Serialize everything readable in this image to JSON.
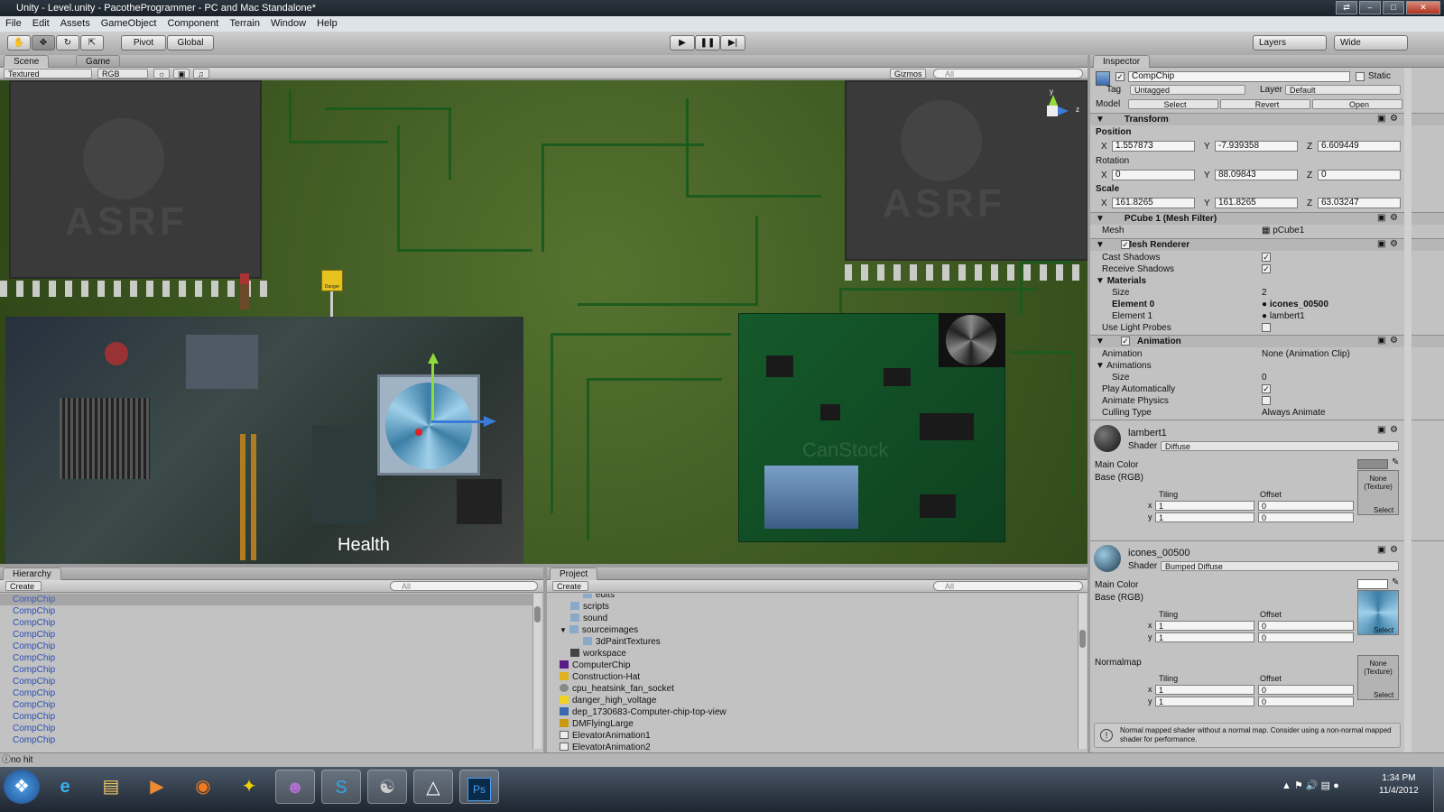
{
  "window": {
    "title": "Unity - Level.unity - PacotheProgrammer - PC and Mac Standalone*"
  },
  "menu": [
    "File",
    "Edit",
    "Assets",
    "GameObject",
    "Component",
    "Terrain",
    "Window",
    "Help"
  ],
  "toolbar": {
    "pivot": "Pivot",
    "global": "Global",
    "layers": "Layers",
    "layout": "Wide"
  },
  "scene": {
    "tabs": [
      "Scene",
      "Game"
    ],
    "render_mode": "Textured",
    "color_mode": "RGB",
    "gizmos": "Gizmos",
    "search_placeholder": "All",
    "gizmo_axes": {
      "y": "y",
      "z": "z"
    },
    "danger_sign": "Danger",
    "health_label": "Health",
    "watermark": "CanStock",
    "chip_brand": "ASRF"
  },
  "hierarchy": {
    "title": "Hierarchy",
    "create": "Create",
    "search_placeholder": "All",
    "items": [
      "CompChip",
      "CompChip",
      "CompChip",
      "CompChip",
      "CompChip",
      "CompChip",
      "CompChip",
      "CompChip",
      "CompChip",
      "CompChip",
      "CompChip",
      "CompChip",
      "CompChip"
    ]
  },
  "project": {
    "title": "Project",
    "create": "Create",
    "search_placeholder": "All",
    "items": [
      {
        "name": "edits",
        "type": "folder"
      },
      {
        "name": "scripts",
        "type": "folder"
      },
      {
        "name": "sound",
        "type": "folder"
      },
      {
        "name": "sourceimages",
        "type": "folder-open"
      },
      {
        "name": "3dPaintTextures",
        "type": "folder"
      },
      {
        "name": "workspace",
        "type": "scene"
      },
      {
        "name": "ComputerChip",
        "type": "texture-purple"
      },
      {
        "name": "Construction-Hat",
        "type": "texture-yellow"
      },
      {
        "name": "cpu_heatsink_fan_socket",
        "type": "texture-gray"
      },
      {
        "name": "danger_high_voltage",
        "type": "texture-warn"
      },
      {
        "name": "dep_1730683-Computer-chip-top-view",
        "type": "texture-blue"
      },
      {
        "name": "DMFlyingLarge",
        "type": "texture-yellow"
      },
      {
        "name": "ElevatorAnimation1",
        "type": "anim"
      },
      {
        "name": "ElevatorAnimation2",
        "type": "anim"
      }
    ]
  },
  "inspector": {
    "title": "Inspector",
    "object_name": "CompChip",
    "static_label": "Static",
    "tag_label": "Tag",
    "tag_value": "Untagged",
    "layer_label": "Layer",
    "layer_value": "Default",
    "model_label": "Model",
    "model_buttons": [
      "Select",
      "Revert",
      "Open"
    ],
    "transform": {
      "title": "Transform",
      "position_label": "Position",
      "position": {
        "x": "1.557873",
        "y": "-7.939358",
        "z": "6.609449"
      },
      "rotation_label": "Rotation",
      "rotation": {
        "x": "0",
        "y": "88.09843",
        "z": "0"
      },
      "scale_label": "Scale",
      "scale": {
        "x": "161.8265",
        "y": "161.8265",
        "z": "63.03247"
      }
    },
    "mesh_filter": {
      "title": "PCube 1 (Mesh Filter)",
      "mesh_label": "Mesh",
      "mesh_value": "pCube1"
    },
    "mesh_renderer": {
      "title": "Mesh Renderer",
      "cast_shadows": "Cast Shadows",
      "receive_shadows": "Receive Shadows",
      "materials": "Materials",
      "size_label": "Size",
      "size_value": "2",
      "element0_label": "Element 0",
      "element0_value": "icones_00500",
      "element1_label": "Element 1",
      "element1_value": "lambert1",
      "light_probes": "Use Light Probes"
    },
    "animation": {
      "title": "Animation",
      "animation_label": "Animation",
      "animation_value": "None (Animation Clip)",
      "animations_label": "Animations",
      "size_label": "Size",
      "size_value": "0",
      "play_auto": "Play Automatically",
      "animate_physics": "Animate Physics",
      "culling_label": "Culling Type",
      "culling_value": "Always Animate"
    },
    "material1": {
      "name": "lambert1",
      "shader_label": "Shader",
      "shader": "Diffuse",
      "main_color": "Main Color",
      "base": "Base (RGB)",
      "tiling": "Tiling",
      "offset": "Offset",
      "tx": "1",
      "ty": "1",
      "ox": "0",
      "oy": "0",
      "texture_none": "None (Texture)",
      "select": "Select"
    },
    "material2": {
      "name": "icones_00500",
      "shader_label": "Shader",
      "shader": "Bumped Diffuse",
      "main_color": "Main Color",
      "base": "Base (RGB)",
      "tiling": "Tiling",
      "offset": "Offset",
      "tx": "1",
      "ty": "1",
      "ox": "0",
      "oy": "0",
      "select": "Select",
      "normalmap": "Normalmap",
      "n_tx": "1",
      "n_ty": "1",
      "n_ox": "0",
      "n_oy": "0",
      "texture_none": "None (Texture)"
    },
    "warning": "Normal mapped shader without a normal map. Consider using a non-normal mapped shader for performance."
  },
  "status": {
    "text": "no hit"
  },
  "taskbar": {
    "time": "1:34 PM",
    "date": "11/4/2012",
    "apps": [
      "ie-icon",
      "explorer-icon",
      "media-player-icon",
      "firefox-icon",
      "aim-icon",
      "yahoo-icon",
      "skype-icon",
      "chat-icon",
      "unity-icon",
      "photoshop-icon"
    ],
    "ps_label": "Ps"
  },
  "colors": {
    "pcb_green": "#3d5a20",
    "trace": "#1d5a1d",
    "link_blue": "#2a4fb5",
    "panel": "#c2c2c2"
  }
}
